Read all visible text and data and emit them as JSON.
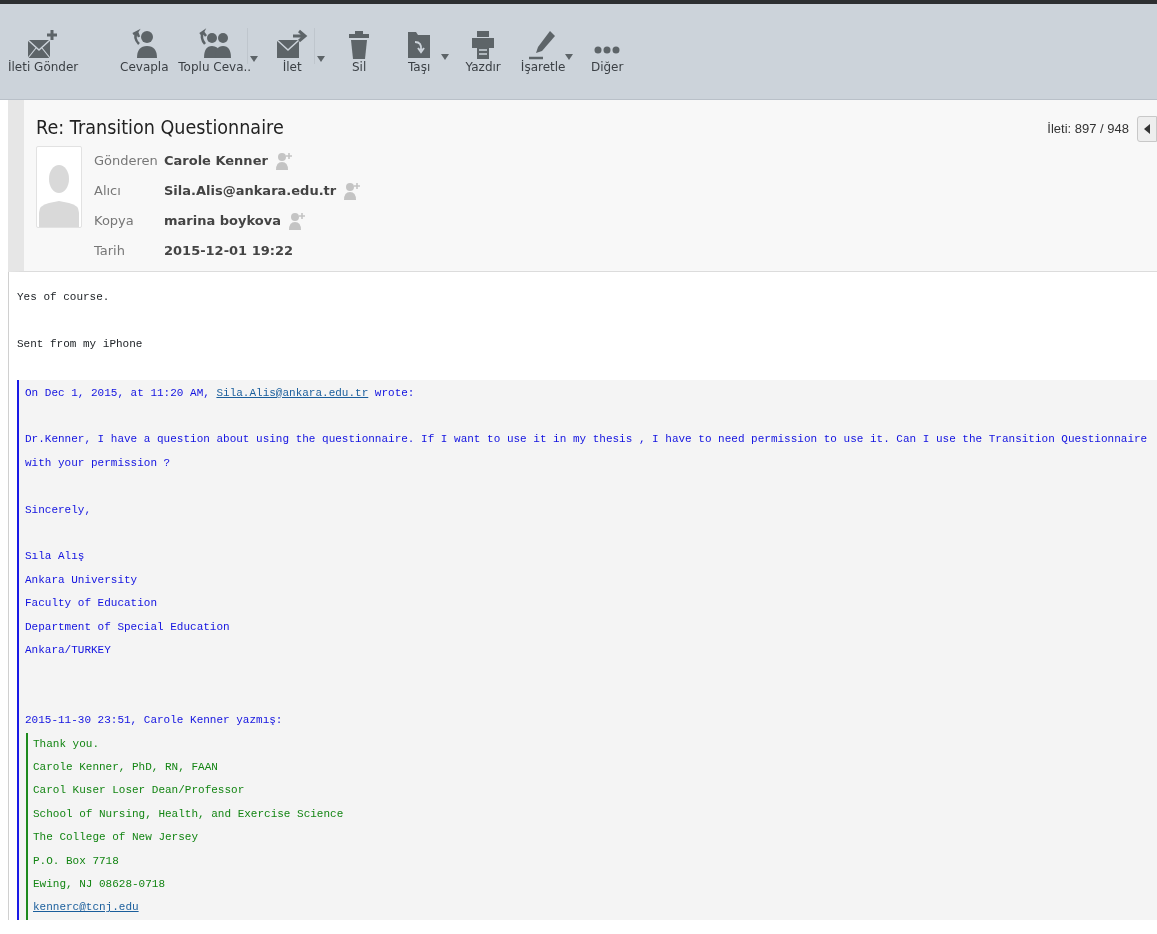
{
  "toolbar": {
    "buttons": [
      {
        "label": "İleti Gönder",
        "dropdown": false
      },
      {
        "label": "Cevapla",
        "dropdown": false
      },
      {
        "label": "Toplu Ceva..",
        "dropdown": true,
        "split": true
      },
      {
        "label": "İlet",
        "dropdown": true,
        "split": true
      },
      {
        "label": "Sil",
        "dropdown": false
      },
      {
        "label": "Taşı",
        "dropdown": true,
        "split": false
      },
      {
        "label": "Yazdır",
        "dropdown": false
      },
      {
        "label": "İşaretle",
        "dropdown": true,
        "split": false
      },
      {
        "label": "Diğer",
        "dropdown": false
      }
    ]
  },
  "message": {
    "subject": "Re: Transition Questionnaire",
    "counter": "İleti: 897 / 948",
    "fields": [
      {
        "label": "Gönderen",
        "value": "Carole Kenner",
        "add_contact": true
      },
      {
        "label": "Alıcı",
        "value": "Sila.Alis@ankara.edu.tr",
        "add_contact": true
      },
      {
        "label": "Kopya",
        "value": "marina boykova",
        "add_contact": true
      },
      {
        "label": "Tarih",
        "value": "2015-12-01 19:22",
        "add_contact": false
      }
    ]
  },
  "body": {
    "lines": [
      "Yes of course.",
      "Sent from my iPhone"
    ],
    "quote": {
      "attribution": {
        "before": "On Dec 1, 2015, at 11:20 AM, ",
        "link": "Sila.Alis@ankara.edu.tr",
        "after": " wrote:"
      },
      "paragraphs": [
        [
          "Dr.Kenner, I have a question about using the questionnaire. If I want to use it in my thesis , I have to need permission to use it. Can I use the Transition Questionnaire with your permission ?"
        ],
        [
          "Sincerely,"
        ],
        [
          "Sıla Alış",
          "Ankara University",
          "Faculty of Education",
          "Department of Special Education",
          "Ankara/TURKEY"
        ]
      ],
      "nested": {
        "attribution": "2015-11-30 23:51, Carole Kenner yazmış:",
        "lines": [
          {
            "text": "Thank you.",
            "kind": "text"
          },
          {
            "text": "Carole Kenner, PhD, RN, FAAN",
            "kind": "text"
          },
          {
            "text": "Carol Kuser Loser Dean/Professor",
            "kind": "text"
          },
          {
            "text": "School of Nursing, Health, and Exercise Science",
            "kind": "text"
          },
          {
            "text": "The College of New Jersey",
            "kind": "text"
          },
          {
            "text": "P.O. Box 7718",
            "kind": "text"
          },
          {
            "text": "Ewing, NJ 08628-0718",
            "kind": "text"
          },
          {
            "text": "kennerc@tcnj.edu",
            "kind": "link"
          }
        ]
      }
    }
  }
}
